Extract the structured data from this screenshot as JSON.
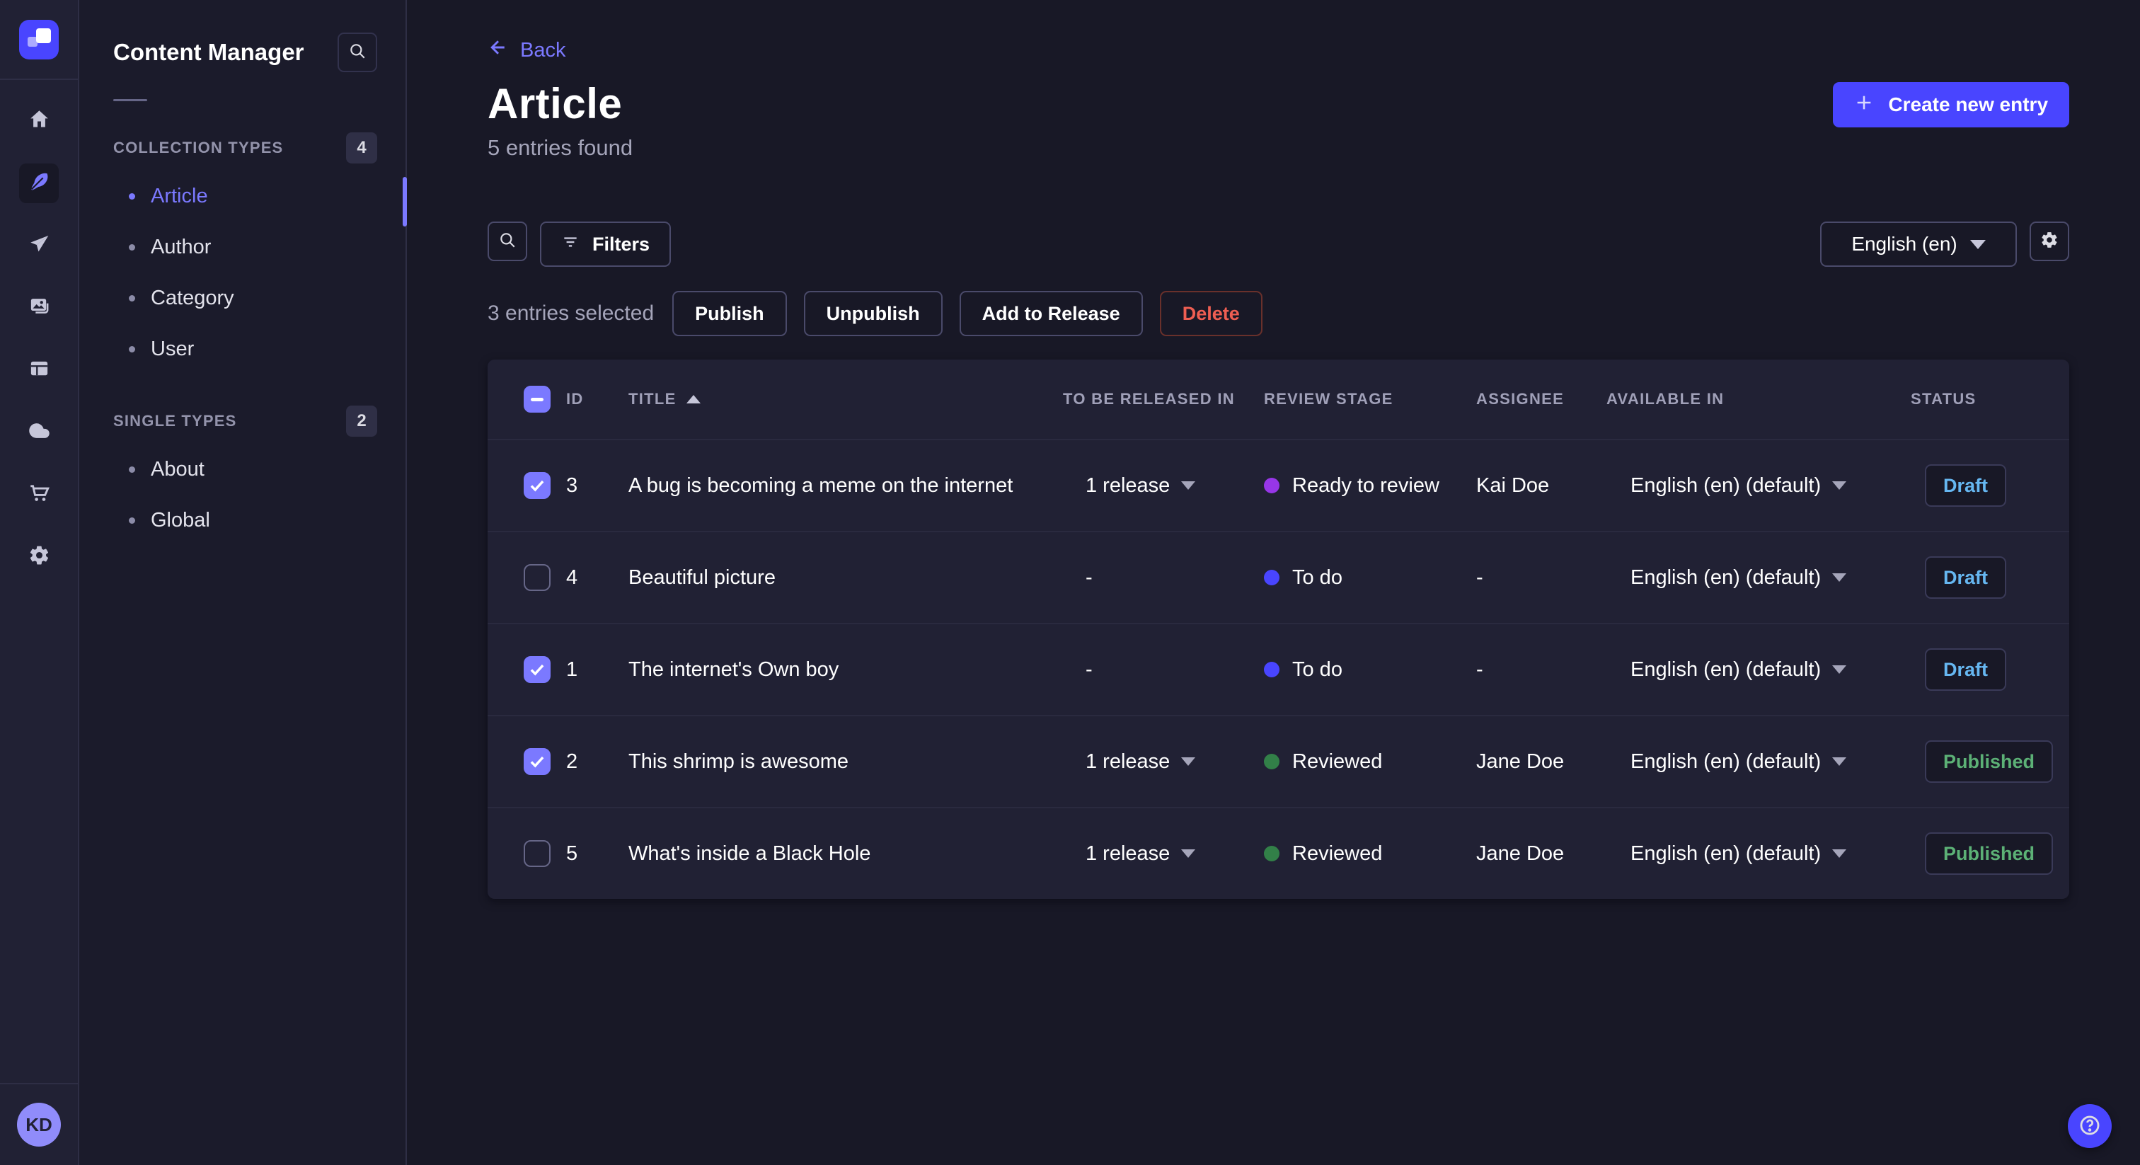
{
  "rail": {
    "items": [
      {
        "name": "home",
        "icon": "home-icon",
        "active": false
      },
      {
        "name": "content-manager",
        "icon": "feather-icon",
        "active": true
      },
      {
        "name": "releases",
        "icon": "paper-plane-icon",
        "active": false
      },
      {
        "name": "media-library",
        "icon": "pictures-icon",
        "active": false
      },
      {
        "name": "content-type-builder",
        "icon": "layout-icon",
        "active": false
      },
      {
        "name": "deploy",
        "icon": "cloud-icon",
        "active": false
      },
      {
        "name": "marketplace",
        "icon": "cart-icon",
        "active": false
      },
      {
        "name": "settings",
        "icon": "gear-icon",
        "active": false
      }
    ],
    "avatar_initials": "KD"
  },
  "sidebar": {
    "title": "Content Manager",
    "sections": [
      {
        "label": "COLLECTION TYPES",
        "badge": "4",
        "items": [
          {
            "label": "Article",
            "active": true
          },
          {
            "label": "Author",
            "active": false
          },
          {
            "label": "Category",
            "active": false
          },
          {
            "label": "User",
            "active": false
          }
        ]
      },
      {
        "label": "SINGLE TYPES",
        "badge": "2",
        "items": [
          {
            "label": "About",
            "active": false
          },
          {
            "label": "Global",
            "active": false
          }
        ]
      }
    ]
  },
  "header": {
    "back_label": "Back",
    "title": "Article",
    "subtitle": "5 entries found",
    "create_button": "Create new entry"
  },
  "toolbar": {
    "filters_label": "Filters",
    "locale_value": "English (en)"
  },
  "selection": {
    "label": "3 entries selected",
    "publish": "Publish",
    "unpublish": "Unpublish",
    "add_to_release": "Add to Release",
    "delete": "Delete"
  },
  "table": {
    "columns": [
      "ID",
      "TITLE",
      "TO BE RELEASED IN",
      "REVIEW STAGE",
      "ASSIGNEE",
      "AVAILABLE IN",
      "STATUS"
    ],
    "sorted_column": "TITLE",
    "sort_direction": "asc",
    "rows": [
      {
        "checked": true,
        "id": "3",
        "title": "A bug is becoming a meme on the internet",
        "release": "1 release",
        "stage": "Ready to review",
        "stage_color": "#9736e8",
        "assignee": "Kai Doe",
        "locale": "English (en) (default)",
        "status": "Draft"
      },
      {
        "checked": false,
        "id": "4",
        "title": "Beautiful picture",
        "release": "-",
        "stage": "To do",
        "stage_color": "#4945ff",
        "assignee": "-",
        "locale": "English (en) (default)",
        "status": "Draft"
      },
      {
        "checked": true,
        "id": "1",
        "title": "The internet's Own boy",
        "release": "-",
        "stage": "To do",
        "stage_color": "#4945ff",
        "assignee": "-",
        "locale": "English (en) (default)",
        "status": "Draft"
      },
      {
        "checked": true,
        "id": "2",
        "title": "This shrimp is awesome",
        "release": "1 release",
        "stage": "Reviewed",
        "stage_color": "#328048",
        "assignee": "Jane Doe",
        "locale": "English (en) (default)",
        "status": "Published"
      },
      {
        "checked": false,
        "id": "5",
        "title": "What's inside a Black Hole",
        "release": "1 release",
        "stage": "Reviewed",
        "stage_color": "#328048",
        "assignee": "Jane Doe",
        "locale": "English (en) (default)",
        "status": "Published"
      }
    ]
  },
  "colors": {
    "accent": "#4945ff",
    "accent_light": "#7b79ff",
    "draft_text": "#66b7f1",
    "published_text": "#5cb176",
    "danger_text": "#ee5e52"
  }
}
